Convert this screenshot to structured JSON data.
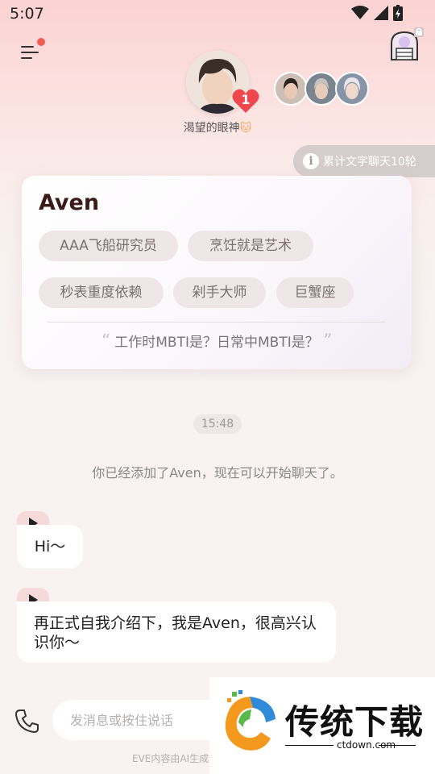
{
  "status_bar": {
    "time": "5:07"
  },
  "character": {
    "name": "渴望的眼神",
    "heart_count": "1",
    "card_name": "Aven",
    "tags": [
      "AAA飞船研究员",
      "烹饪就是艺术",
      "秒表重度依赖",
      "剁手大师",
      "巨蟹座"
    ],
    "quote": "工作时MBTI是？日常中MBTI是？"
  },
  "info_pill": {
    "label": "累计文字聊天10轮"
  },
  "chat": {
    "timestamp": "15:48",
    "system_message": "你已经添加了Aven，现在可以开始聊天了。",
    "messages": [
      {
        "text": "Hi～"
      },
      {
        "text": "再正式自我介绍下，我是Aven，很高兴认识你～"
      }
    ]
  },
  "input": {
    "placeholder": "发消息或按住说话"
  },
  "footer": {
    "note": "EVE内容由AI生成"
  },
  "watermark": {
    "brand": "传统下载",
    "url": "ctdown.com"
  },
  "colors": {
    "accent": "#f15d4e",
    "heart": "#f0474f",
    "bubble": "#ffffff",
    "play_tab": "#f6d9da"
  }
}
